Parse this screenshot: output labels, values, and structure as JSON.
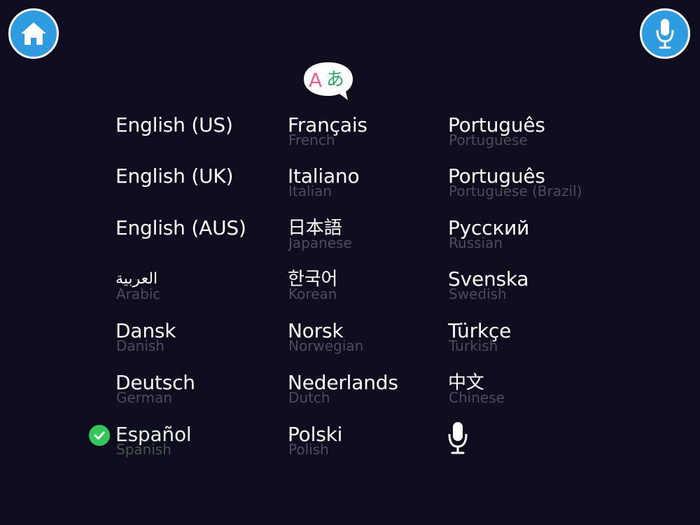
{
  "icons": {
    "home": "home-icon",
    "microphone": "microphone-icon",
    "translate": "translate-icon",
    "check": "check-icon"
  },
  "colors": {
    "background": "#0d0d1f",
    "button": "#2f9be0",
    "primary_text": "#ffffff",
    "secondary_text": "#4c4c5c",
    "check": "#33c65b"
  },
  "logo": {
    "latin_glyph": "A",
    "kana_glyph": "あ"
  },
  "languages": [
    {
      "name": "English (US)",
      "sub": ""
    },
    {
      "name": "English (UK)",
      "sub": ""
    },
    {
      "name": "English (AUS)",
      "sub": ""
    },
    {
      "name": "العربية",
      "sub": "Arabic"
    },
    {
      "name": "Dansk",
      "sub": "Danish"
    },
    {
      "name": "Deutsch",
      "sub": "German"
    },
    {
      "name": "Español",
      "sub": "Spanish",
      "selected": true
    },
    {
      "name": "Français",
      "sub": "French"
    },
    {
      "name": "Italiano",
      "sub": "Italian"
    },
    {
      "name": "日本語",
      "sub": "Japanese"
    },
    {
      "name": "한국어",
      "sub": "Korean"
    },
    {
      "name": "Norsk",
      "sub": "Norwegian"
    },
    {
      "name": "Nederlands",
      "sub": "Dutch"
    },
    {
      "name": "Polski",
      "sub": "Polish"
    },
    {
      "name": "Português",
      "sub": "Portuguese"
    },
    {
      "name": "Português",
      "sub": "Portuguese (Brazil)"
    },
    {
      "name": "Русский",
      "sub": "Russian"
    },
    {
      "name": "Svenska",
      "sub": "Swedish"
    },
    {
      "name": "Türkçe",
      "sub": "Turkish"
    },
    {
      "name": "中文",
      "sub": "Chinese"
    }
  ]
}
